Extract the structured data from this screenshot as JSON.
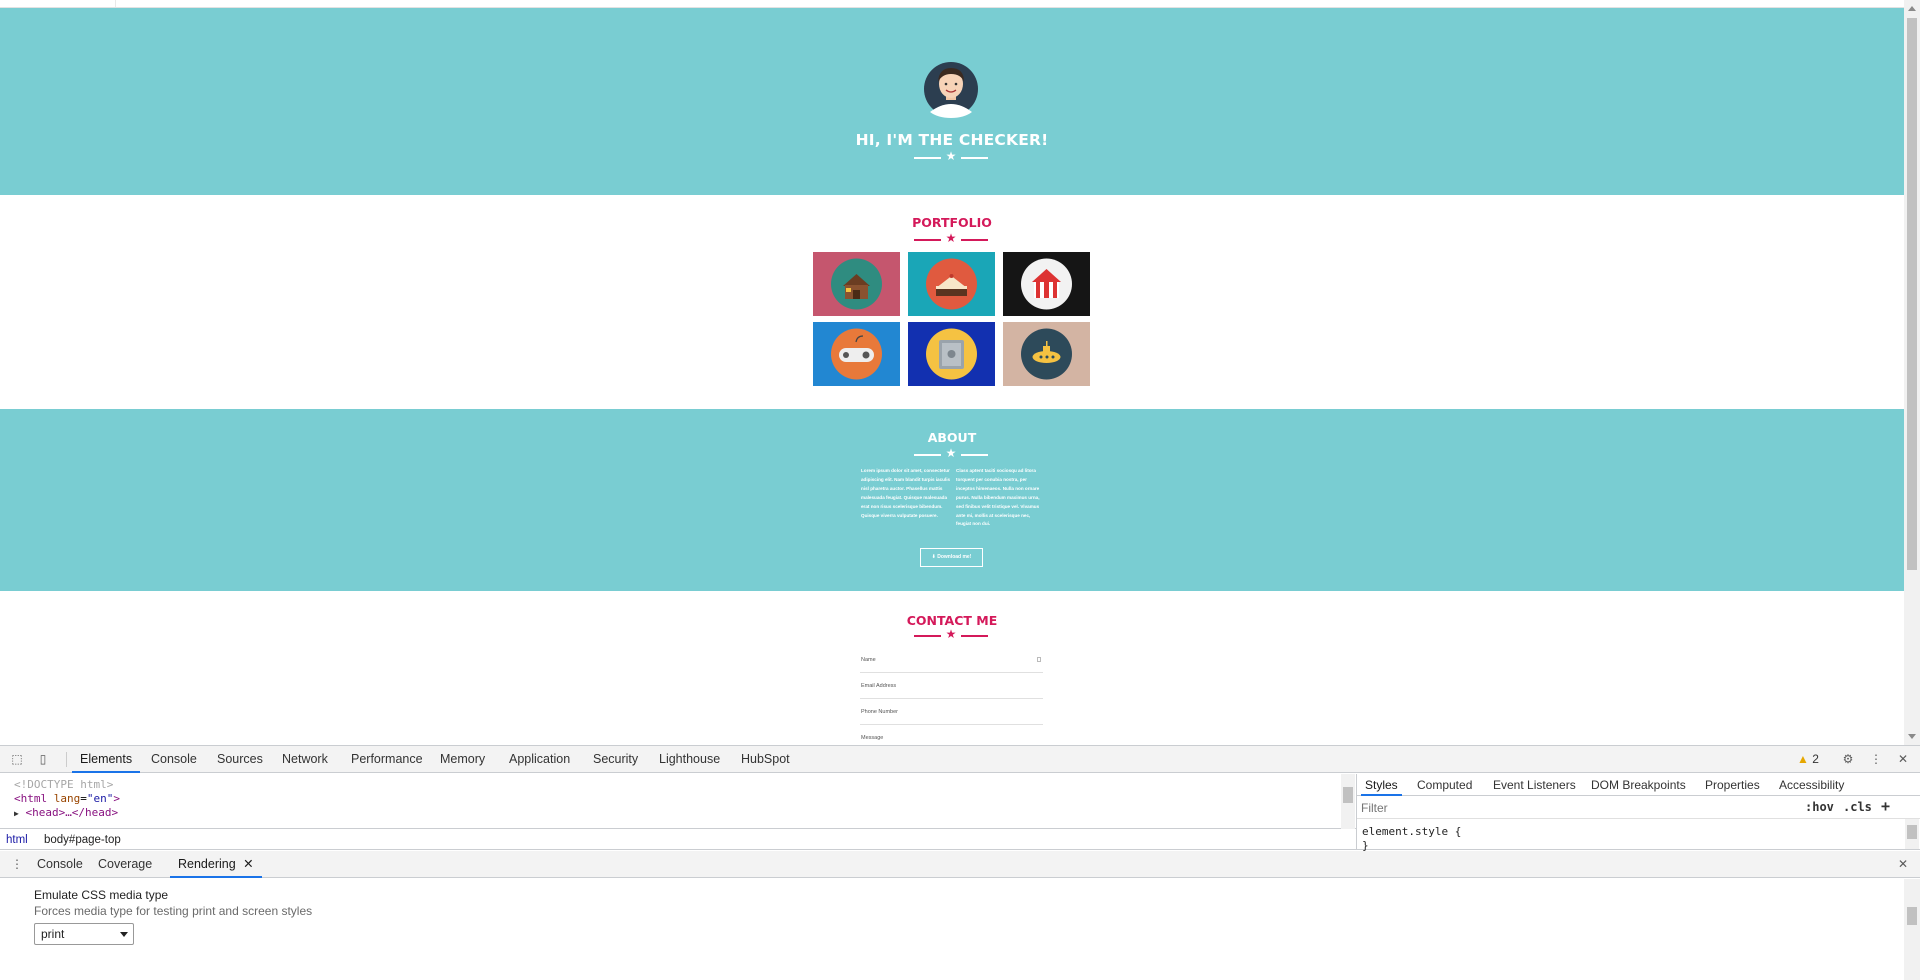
{
  "hero": {
    "title": "HI, I'M THE CHECKER!"
  },
  "portfolio": {
    "title": "PORTFOLIO",
    "tiles": [
      {
        "name": "cabin",
        "bg": "#c5566e",
        "disc": "#2f8c80"
      },
      {
        "name": "cake",
        "bg": "#1aa6b7",
        "disc": "#e05a3f"
      },
      {
        "name": "circus",
        "bg": "#151515",
        "disc": "#f2f2f2"
      },
      {
        "name": "game",
        "bg": "#2287d2",
        "disc": "#e8793a"
      },
      {
        "name": "safe",
        "bg": "#1230b0",
        "disc": "#f5c242"
      },
      {
        "name": "submarine",
        "bg": "#d3b4a3",
        "disc": "#2d4a5a"
      }
    ]
  },
  "about": {
    "title": "ABOUT",
    "col1": "Lorem ipsum dolor sit amet, consectetur adipiscing elit. Nam blandit turpis iaculis nisl pharetra auctor. Phasellus mattis malesuada feugiat. Quisque malesuada erat non risus scelerisque bibendum. Quisque viverra vulputate posuere.",
    "col2": "Class aptent taciti sociosqu ad litora torquent per conubia nostra, per inceptos himenaeos. Nulla non ornare purus. Nulla bibendum maximus urna, sed finibus velit tristique vel. Vivamus ante mi, mollis at scelerisque nec, feugiat non dui.",
    "download": "Download me!"
  },
  "contact": {
    "title": "CONTACT ME",
    "fields": [
      "Name",
      "Email Address",
      "Phone Number",
      "Message"
    ]
  },
  "devtools": {
    "tabs": [
      "Elements",
      "Console",
      "Sources",
      "Network",
      "Performance",
      "Memory",
      "Application",
      "Security",
      "Lighthouse",
      "HubSpot"
    ],
    "warnings": "2",
    "code": {
      "doctype": "<!DOCTYPE html>",
      "html_open": "<html",
      "lang_attr": "lang",
      "lang_val": "\"en\"",
      "head": "<head>…</head>"
    },
    "breadcrumb": [
      "html",
      "body#page-top"
    ],
    "styles_tabs": [
      "Styles",
      "Computed",
      "Event Listeners",
      "DOM Breakpoints",
      "Properties",
      "Accessibility"
    ],
    "filter_placeholder": "Filter",
    "hov": ":hov",
    "cls": ".cls",
    "element_style": "element.style {\n}",
    "drawer_tabs": [
      "Console",
      "Coverage",
      "Rendering"
    ],
    "rendering": {
      "title": "Emulate CSS media type",
      "subtitle": "Forces media type for testing print and screen styles",
      "selected": "print"
    }
  }
}
